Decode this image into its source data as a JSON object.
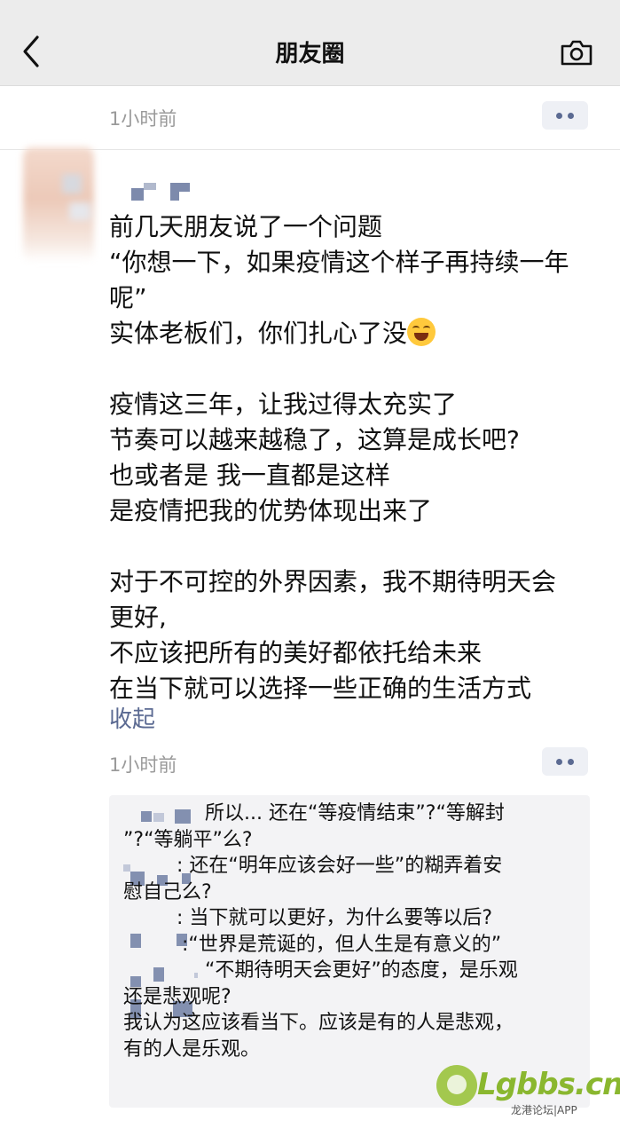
{
  "header": {
    "title": "朋友圈",
    "back_icon": "chevron-left-icon",
    "camera_icon": "camera-icon"
  },
  "prev_post": {
    "time": "1小时前"
  },
  "post": {
    "lines": [
      "前几天朋友说了一个问题",
      "“你想一下，如果疫情这个样子再持续一年",
      "呢”",
      "实体老板们，你们扎心了没",
      "",
      "疫情这三年，让我过得太充实了",
      "节奏可以越来越稳了，这算是成长吧?",
      "也或者是 我一直都是这样",
      "是疫情把我的优势体现出来了",
      "",
      "对于不可控的外界因素，我不期待明天会",
      "更好,",
      "不应该把所有的美好都依托给未来",
      "在当下就可以选择一些正确的生活方式"
    ],
    "emoji": "laughing-tears-emoji",
    "collapse_label": "收起",
    "time": "1小时前"
  },
  "comments": {
    "lines": [
      "所以... 还在“等疫情结束”?“等解封",
      "”?“等躺平”么?",
      ": 还在“明年应该会好一些”的糊弄着安",
      "慰自己么?",
      ": 当下就可以更好，为什么要等以后?",
      ":“世界是荒诞的，但人生是有意义的”",
      "“不期待明天会更好”的态度，是乐观",
      "还是悲观呢?",
      "我认为这应该看当下。应该是有的人是悲观，",
      "有的人是乐观。"
    ]
  },
  "watermark": {
    "name": "Lgbbs.cn",
    "sub": "龙港论坛|APP"
  }
}
